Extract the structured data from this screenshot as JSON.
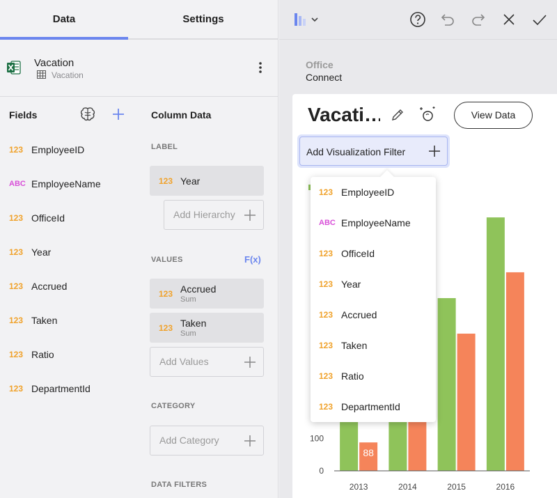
{
  "tabs": {
    "data_label": "Data",
    "settings_label": "Settings"
  },
  "source": {
    "title": "Vacation",
    "subtitle": "Vacation"
  },
  "fields_panel": {
    "heading": "Fields",
    "items": [
      {
        "type": "123",
        "name": "EmployeeID"
      },
      {
        "type": "ABC",
        "name": "EmployeeName"
      },
      {
        "type": "123",
        "name": "OfficeId"
      },
      {
        "type": "123",
        "name": "Year"
      },
      {
        "type": "123",
        "name": "Accrued"
      },
      {
        "type": "123",
        "name": "Taken"
      },
      {
        "type": "123",
        "name": "Ratio"
      },
      {
        "type": "123",
        "name": "DepartmentId"
      }
    ]
  },
  "column_data": {
    "heading": "Column Data",
    "label_section": "LABEL",
    "label_pill": {
      "type": "123",
      "name": "Year"
    },
    "add_hierarchy": "Add Hierarchy",
    "values_section": "VALUES",
    "fx_label": "F(x)",
    "value_pills": [
      {
        "type": "123",
        "name": "Accrued",
        "sub": "Sum"
      },
      {
        "type": "123",
        "name": "Taken",
        "sub": "Sum"
      }
    ],
    "add_values": "Add Values",
    "category_section": "CATEGORY",
    "add_category": "Add Category",
    "data_filters_section": "DATA FILTERS"
  },
  "breadcrumb": {
    "top": "Office",
    "bottom": "Connect"
  },
  "visualization": {
    "title": "Vacati…",
    "view_data_label": "View Data",
    "filter_button_label": "Add Visualization Filter"
  },
  "filter_dropdown": [
    {
      "type": "123",
      "name": "EmployeeID"
    },
    {
      "type": "ABC",
      "name": "EmployeeName"
    },
    {
      "type": "123",
      "name": "OfficeId"
    },
    {
      "type": "123",
      "name": "Year"
    },
    {
      "type": "123",
      "name": "Accrued"
    },
    {
      "type": "123",
      "name": "Taken"
    },
    {
      "type": "123",
      "name": "Ratio"
    },
    {
      "type": "123",
      "name": "DepartmentId"
    }
  ],
  "colors": {
    "accent": "#6b86ee",
    "numeric_type": "#f0a22b",
    "text_type": "#d84fd8",
    "series_accrued": "#8fc35a",
    "series_taken": "#f5845a",
    "excel_green": "#1d7044"
  },
  "chart_data": {
    "type": "bar",
    "categories": [
      "2013",
      "2014",
      "2015",
      "2016"
    ],
    "series": [
      {
        "values": [
          300,
          300,
          535,
          785
        ]
      },
      {
        "values": [
          88,
          300,
          425,
          615
        ]
      }
    ],
    "ylim": [
      0,
      800
    ],
    "yticks": [
      "0",
      "100"
    ],
    "visible_data_labels": [
      {
        "series": 1,
        "category": 0,
        "text": "88"
      }
    ],
    "grid": false
  }
}
